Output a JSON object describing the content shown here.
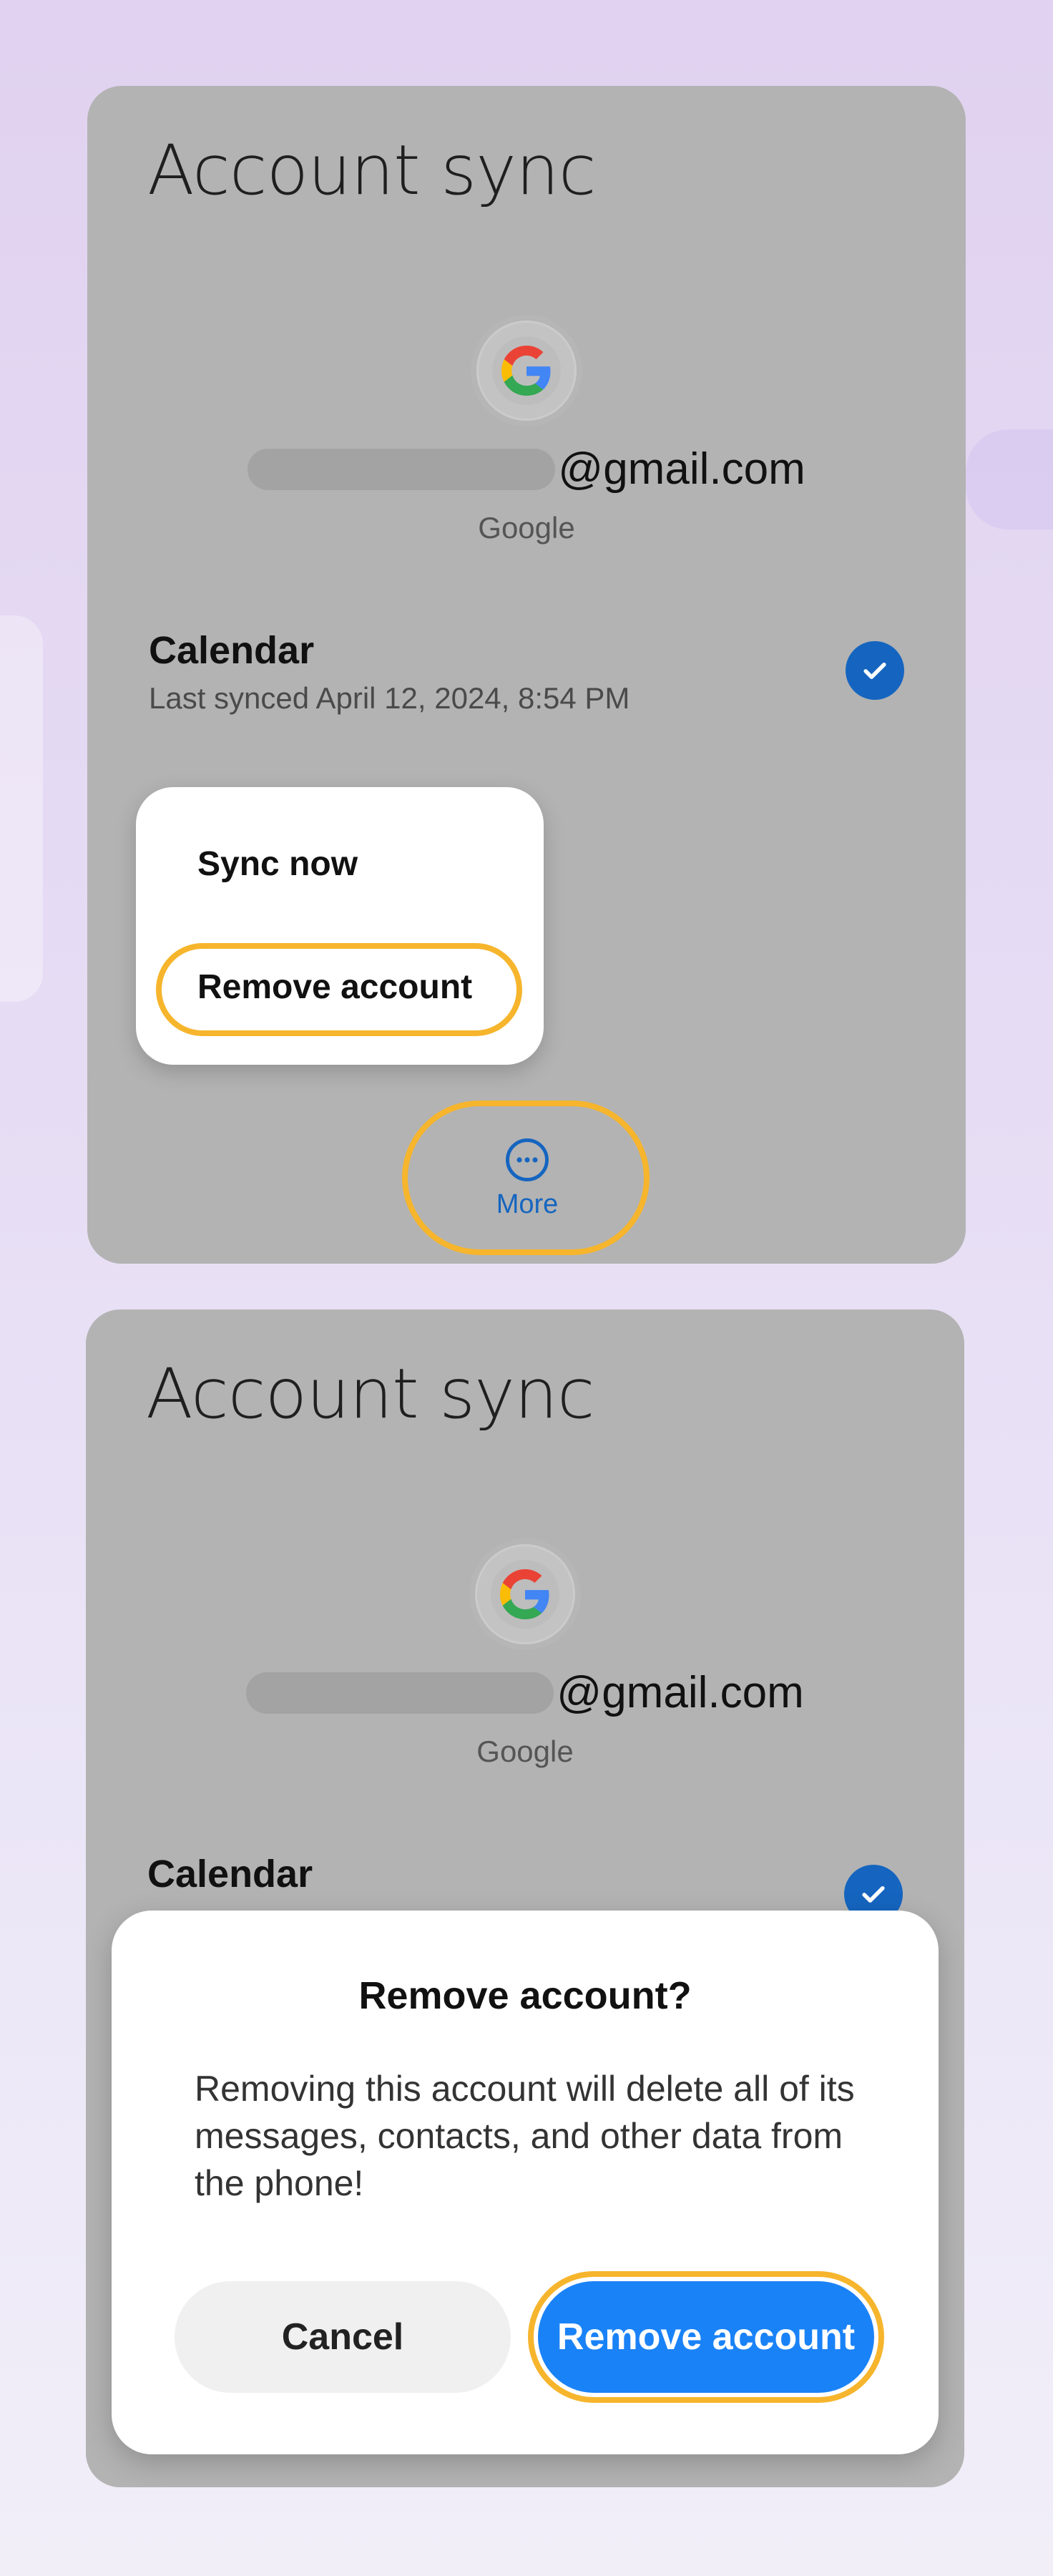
{
  "screen1": {
    "title": "Account sync",
    "email_suffix": "@gmail.com",
    "provider": "Google",
    "sync_item": {
      "name": "Calendar",
      "last_synced": "Last synced April 12, 2024, 8:54 PM",
      "checked": true
    },
    "menu": {
      "items": [
        "Sync now",
        "Remove account"
      ]
    },
    "more_label": "More"
  },
  "screen2": {
    "title": "Account sync",
    "email_suffix": "@gmail.com",
    "provider": "Google",
    "sync_item": {
      "name": "Calendar"
    },
    "dialog": {
      "title": "Remove account?",
      "body": "Removing this account will delete all of its messages, contacts, and other data from the phone!",
      "cancel_label": "Cancel",
      "confirm_label": "Remove account"
    }
  },
  "colors": {
    "accent_highlight": "#f6b52c",
    "primary_blue": "#1a82f7",
    "check_blue": "#1565c0"
  },
  "icons": [
    "google-logo-icon",
    "checkmark-icon",
    "more-dots-icon"
  ]
}
